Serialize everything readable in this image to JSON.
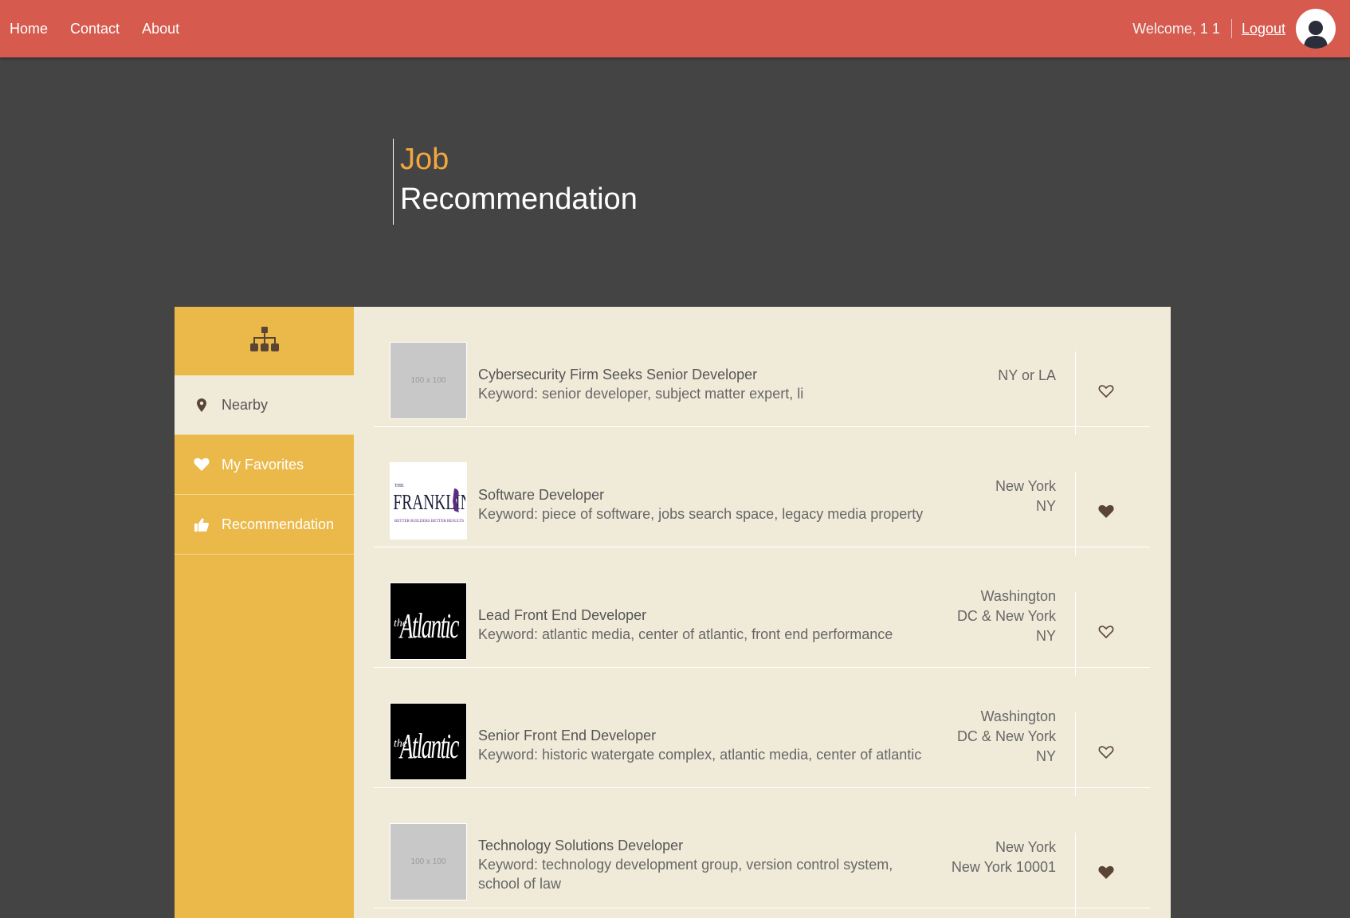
{
  "nav": {
    "links": [
      "Home",
      "Contact",
      "About"
    ],
    "welcome": "Welcome, 1 1",
    "logout": "Logout",
    "avatar_icon": "user-icon"
  },
  "hero": {
    "title_accent": "Job",
    "title_main": "Recommendation"
  },
  "sidebar": {
    "head_icon": "sitemap-icon",
    "items": [
      {
        "label": "Nearby",
        "icon": "map-marker-icon",
        "active": true
      },
      {
        "label": "My Favorites",
        "icon": "heart-icon",
        "active": false
      },
      {
        "label": "Recommendation",
        "icon": "thumbs-up-icon",
        "active": false
      }
    ]
  },
  "jobs": [
    {
      "title": "Cybersecurity Firm Seeks Senior Developer",
      "keyword": "Keyword: senior developer, subject matter expert, li",
      "location": [
        "NY or LA"
      ],
      "logo": "placeholder",
      "logo_text": "100 x 100",
      "favorite": false
    },
    {
      "title": "Software Developer",
      "keyword": "Keyword: piece of software, jobs search space, legacy media property",
      "location": [
        "New York",
        "NY"
      ],
      "logo": "franklin",
      "logo_text": "FRANKLIN REPORT",
      "favorite": true
    },
    {
      "title": "Lead Front End Developer",
      "keyword": "Keyword: atlantic media, center of atlantic, front end performance",
      "location": [
        "Washington",
        "DC & New York",
        "NY"
      ],
      "logo": "atlantic",
      "logo_text": "the Atlantic",
      "favorite": false
    },
    {
      "title": "Senior Front End Developer",
      "keyword": "Keyword: historic watergate complex, atlantic media, center of atlantic",
      "location": [
        "Washington",
        "DC & New York",
        "NY"
      ],
      "logo": "atlantic",
      "logo_text": "the Atlantic",
      "favorite": false
    },
    {
      "title": "Technology Solutions Developer",
      "keyword": "Keyword: technology development group, version control system, school of law",
      "location": [
        "New York",
        "New York 10001"
      ],
      "logo": "placeholder",
      "logo_text": "100 x 100",
      "favorite": true
    }
  ],
  "colors": {
    "navbar": "#d65a4e",
    "accent": "#f2a83e",
    "sidebar": "#ebb94a",
    "panel": "#f0ebd9",
    "heart": "#5a4535"
  }
}
